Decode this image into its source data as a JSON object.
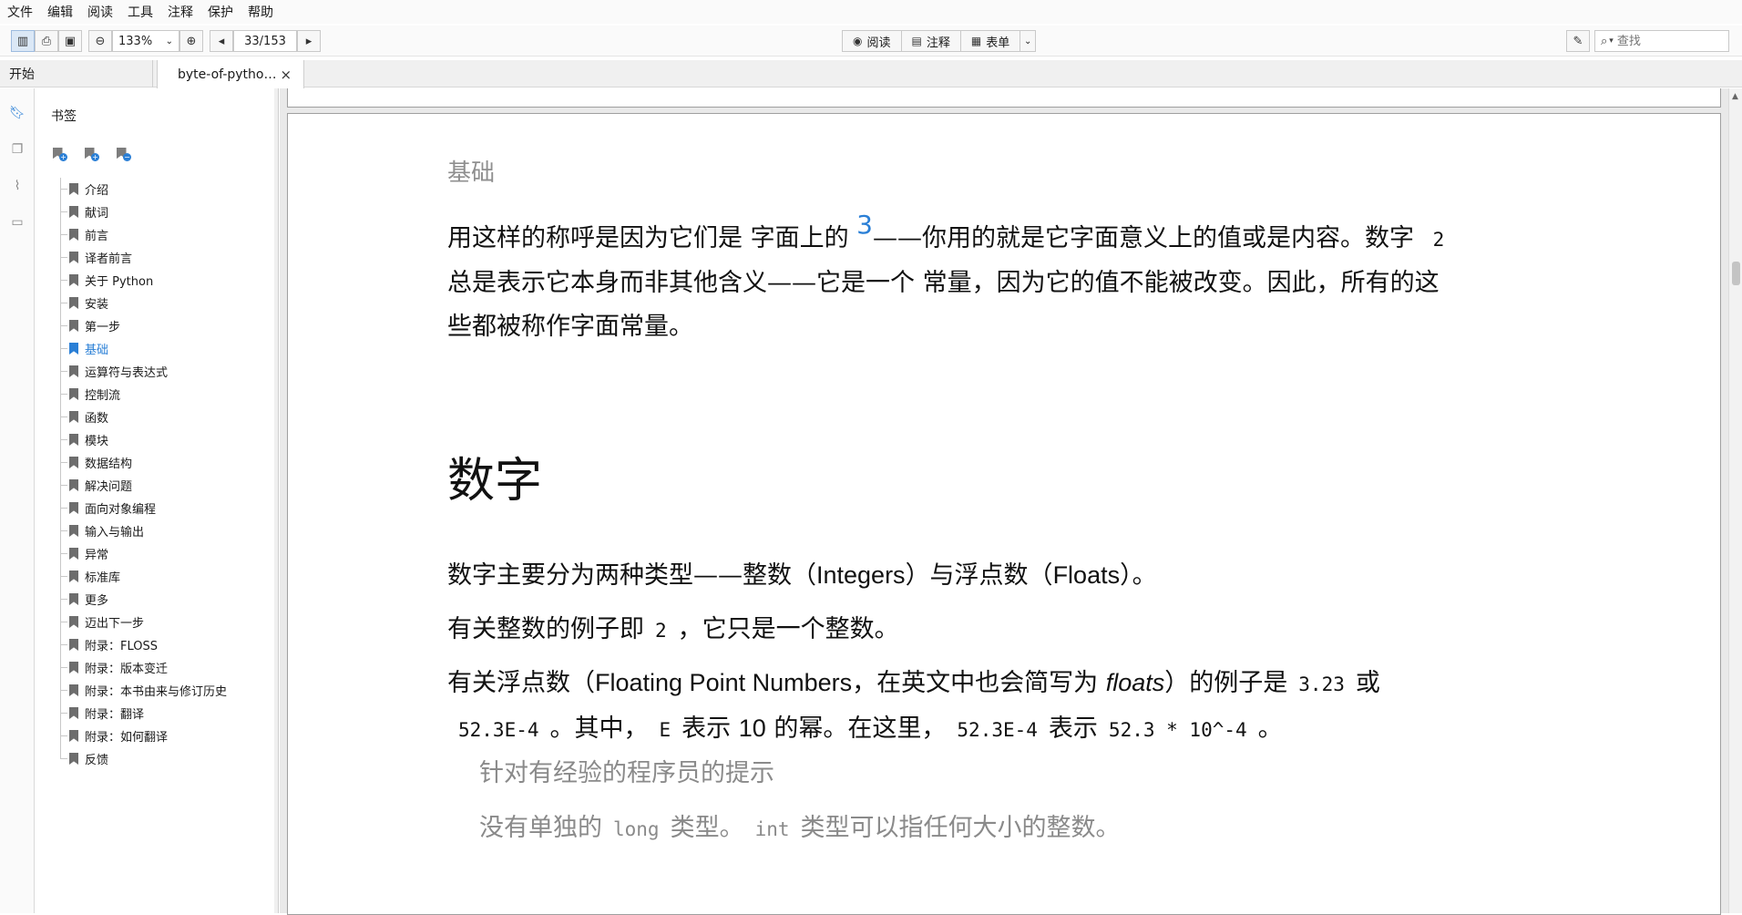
{
  "menu": [
    "文件",
    "编辑",
    "阅读",
    "工具",
    "注释",
    "保护",
    "帮助"
  ],
  "toolbar": {
    "zoom": "133%",
    "page": "33/153",
    "modes": [
      {
        "label": "阅读",
        "icon": "eye-icon",
        "glyph": "◉"
      },
      {
        "label": "注释",
        "icon": "comment-icon",
        "glyph": "▤"
      },
      {
        "label": "表单",
        "icon": "form-icon",
        "glyph": "▦"
      }
    ],
    "search_placeholder": "查找"
  },
  "tabs": {
    "start": "开始",
    "doc": "byte-of-pytho…",
    "close": "×"
  },
  "panel": {
    "title": "书签",
    "bookmarks": [
      "介绍",
      "献词",
      "前言",
      "译者前言",
      "关于 Python",
      "安装",
      "第一步",
      "基础",
      "运算符与表达式",
      "控制流",
      "函数",
      "模块",
      "数据结构",
      "解决问题",
      "面向对象编程",
      "输入与输出",
      "异常",
      "标准库",
      "更多",
      "迈出下一步",
      "附录：FLOSS",
      "附录：版本变迁",
      "附录：本书由来与修订历史",
      "附录：翻译",
      "附录：如何翻译",
      "反馈"
    ],
    "selected_index": 7,
    "accent": "#2a7fd6"
  },
  "page": {
    "running_head": "基础",
    "p1_line1_a": "用这样的称呼是因为它们是 字面上的 ",
    "p1_footnote": "3",
    "p1_line1_b": "——你用的就是它字面意义上的值或是内容。数字 ",
    "p1_num": "2",
    "p1_line2": "总是表示它本身而非其他含义——它是一个 常量，因为它的值不能被改变。因此，所有的这",
    "p1_line3": "些都被称作字面常量。",
    "heading": "数字",
    "p2_a": "数字主要分为两种类型——整数（",
    "p2_integers": "Integers",
    "p2_b": "）与浮点数（",
    "p2_floats": "Floats",
    "p2_c": "）。",
    "p3_a": "有关整数的例子即",
    "p3_code": "2",
    "p3_b": "，它只是一个整数。",
    "p4_a": "有关浮点数（",
    "p4_fpn": "Floating Point Numbers",
    "p4_b": "，在英文中也会简写为 ",
    "p4_floats": "floats",
    "p4_c": "）的例子是",
    "p4_code1": "3.23",
    "p4_d": "或",
    "p4_code2": "52.3E-4",
    "p4_e": "。其中，",
    "p4_code3": "E",
    "p4_f": "表示 ",
    "p4_ten": "10",
    "p4_g": " 的幂。在这里，",
    "p4_code4": "52.3E-4",
    "p4_h": "表示",
    "p4_code5": "52.3 * 10^-4",
    "p4_i": "。",
    "tip_title": "针对有经验的程序员的提示",
    "tip_a": "没有单独的",
    "tip_code1": "long",
    "tip_b": "类型。",
    "tip_code2": "int",
    "tip_c": "类型可以指任何大小的整数。"
  }
}
